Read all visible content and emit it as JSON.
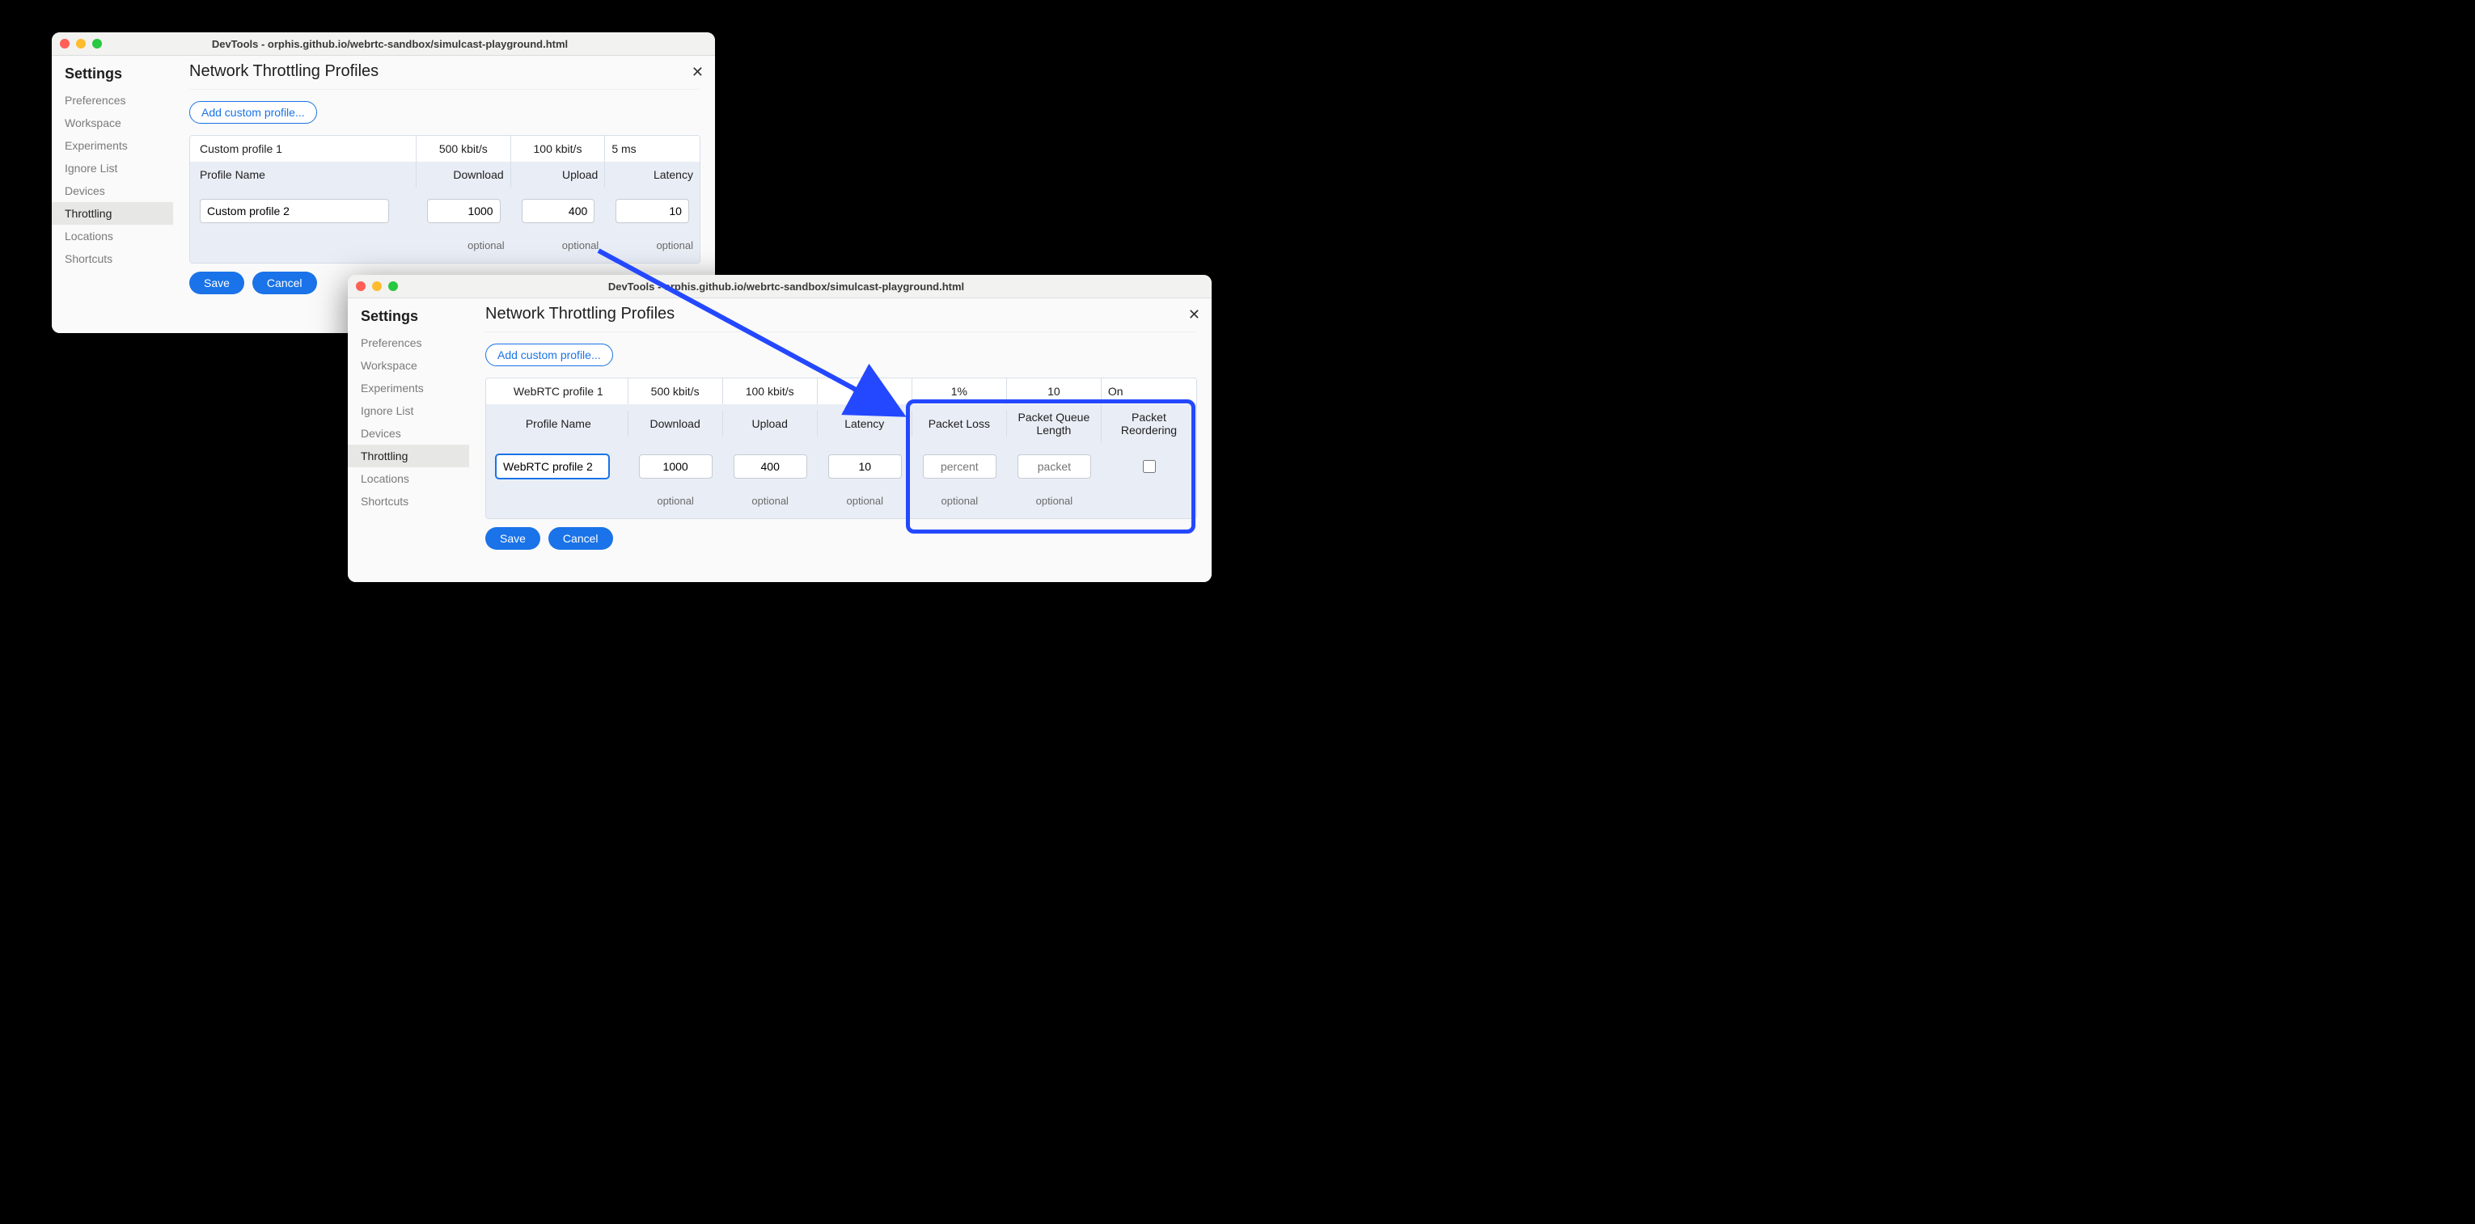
{
  "window_a": {
    "title": "DevTools - orphis.github.io/webrtc-sandbox/simulcast-playground.html",
    "settings_label": "Settings",
    "sidebar": {
      "items": [
        {
          "label": "Preferences"
        },
        {
          "label": "Workspace"
        },
        {
          "label": "Experiments"
        },
        {
          "label": "Ignore List"
        },
        {
          "label": "Devices"
        },
        {
          "label": "Throttling"
        },
        {
          "label": "Locations"
        },
        {
          "label": "Shortcuts"
        }
      ],
      "active_index": 5
    },
    "main": {
      "heading": "Network Throttling Profiles",
      "add_label": "Add custom profile...",
      "columns": [
        "Profile Name",
        "Download",
        "Upload",
        "Latency"
      ],
      "data_row": {
        "name": "Custom profile 1",
        "download": "500 kbit/s",
        "upload": "100 kbit/s",
        "latency": "5 ms"
      },
      "edit_row": {
        "name": "Custom profile 2",
        "download": "1000",
        "upload": "400",
        "latency": "10"
      },
      "optional_label": "optional",
      "save_label": "Save",
      "cancel_label": "Cancel"
    }
  },
  "window_b": {
    "title": "DevTools - orphis.github.io/webrtc-sandbox/simulcast-playground.html",
    "settings_label": "Settings",
    "sidebar": {
      "items": [
        {
          "label": "Preferences"
        },
        {
          "label": "Workspace"
        },
        {
          "label": "Experiments"
        },
        {
          "label": "Ignore List"
        },
        {
          "label": "Devices"
        },
        {
          "label": "Throttling"
        },
        {
          "label": "Locations"
        },
        {
          "label": "Shortcuts"
        }
      ],
      "active_index": 5
    },
    "main": {
      "heading": "Network Throttling Profiles",
      "add_label": "Add custom profile...",
      "columns": [
        "Profile Name",
        "Download",
        "Upload",
        "Latency",
        "Packet Loss",
        "Packet Queue Length",
        "Packet Reordering"
      ],
      "data_row": {
        "name": "WebRTC profile 1",
        "download": "500 kbit/s",
        "upload": "100 kbit/s",
        "latency": "5 ms",
        "packet_loss": "1%",
        "packet_queue": "10",
        "packet_reorder": "On"
      },
      "edit_row": {
        "name": "WebRTC profile 2",
        "download": "1000",
        "upload": "400",
        "latency": "10",
        "packet_loss_placeholder": "percent",
        "packet_queue_placeholder": "packet",
        "packet_reorder_checked": false
      },
      "optional_label": "optional",
      "save_label": "Save",
      "cancel_label": "Cancel"
    }
  }
}
